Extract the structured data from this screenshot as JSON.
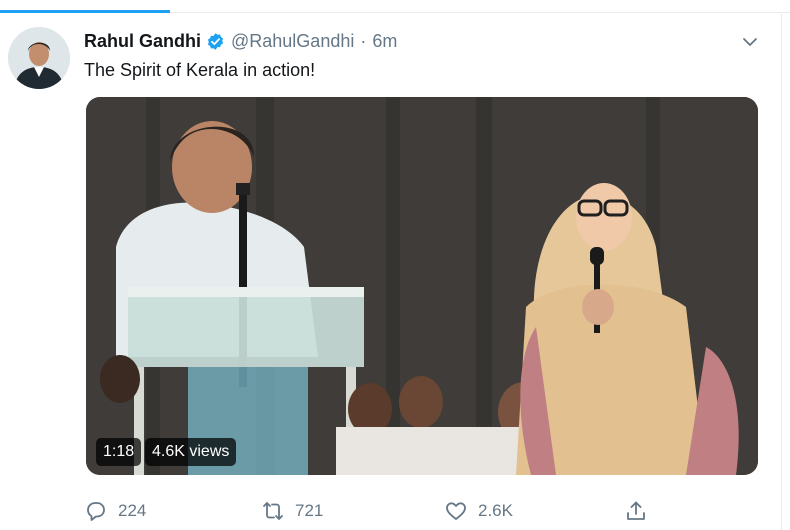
{
  "tweet": {
    "author_name": "Rahul Gandhi",
    "handle": "@RahulGandhi",
    "separator": "·",
    "time": "6m",
    "verified": true,
    "text": "The Spirit of Kerala in action!",
    "menu_icon": "chevron-down-icon"
  },
  "media": {
    "type": "video",
    "duration": "1:18",
    "views": "4.6K views"
  },
  "actions": {
    "reply_count": "224",
    "retweet_count": "721",
    "like_count": "2.6K",
    "reply_icon": "reply-icon",
    "retweet_icon": "retweet-icon",
    "like_icon": "heart-icon",
    "share_icon": "share-icon"
  },
  "colors": {
    "accent": "#1da1f2",
    "text_primary": "#14171a",
    "text_secondary": "#657786",
    "divider": "#e6ecf0"
  }
}
